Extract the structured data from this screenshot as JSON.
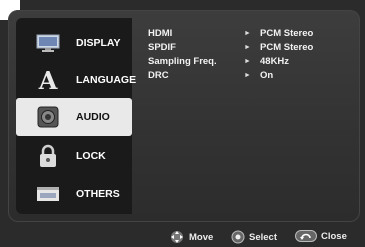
{
  "sidebar": {
    "items": [
      {
        "label": "DISPLAY",
        "icon": "display-icon"
      },
      {
        "label": "LANGUAGE",
        "icon": "language-icon"
      },
      {
        "label": "AUDIO",
        "icon": "audio-icon",
        "selected": true
      },
      {
        "label": "LOCK",
        "icon": "lock-icon"
      },
      {
        "label": "OTHERS",
        "icon": "others-icon"
      }
    ]
  },
  "settings": [
    {
      "label": "HDMI",
      "value": "PCM Stereo"
    },
    {
      "label": "SPDIF",
      "value": "PCM Stereo"
    },
    {
      "label": "Sampling Freq.",
      "value": "48KHz"
    },
    {
      "label": "DRC",
      "value": "On"
    }
  ],
  "footer": {
    "move": "Move",
    "select": "Select",
    "close": "Close"
  },
  "colors": {
    "background": "#2b2b2b",
    "sidebar": "#1a1a1a",
    "selected_item": "#e9e9e9",
    "text": "#ffffff"
  }
}
